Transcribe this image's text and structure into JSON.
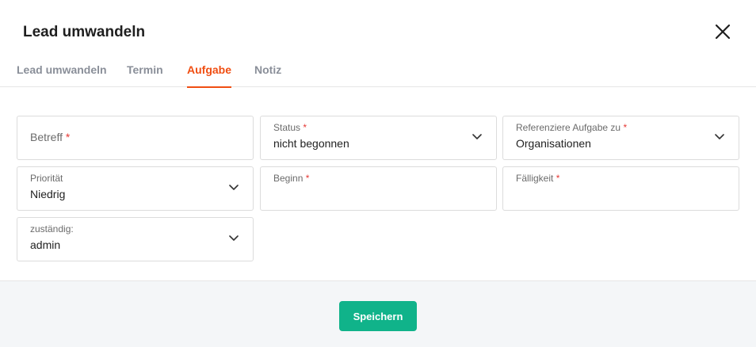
{
  "dialog": {
    "title": "Lead umwandeln",
    "close_icon": "close-icon"
  },
  "tabs": [
    {
      "label": "Lead umwandeln",
      "active": false
    },
    {
      "label": "Termin",
      "active": false
    },
    {
      "label": "Aufgabe",
      "active": true
    },
    {
      "label": "Notiz",
      "active": false
    }
  ],
  "form": {
    "betreff": {
      "label": "Betreff",
      "required_mark": "*",
      "value": ""
    },
    "status": {
      "label": "Status",
      "required_mark": "*",
      "value": "nicht begonnen"
    },
    "referenz": {
      "label": "Referenziere Aufgabe zu",
      "required_mark": "*",
      "value": "Organisationen"
    },
    "prioritaet": {
      "label": "Priorität",
      "value": "Niedrig"
    },
    "beginn": {
      "label": "Beginn",
      "required_mark": "*",
      "value": ""
    },
    "faelligkeit": {
      "label": "Fälligkeit",
      "required_mark": "*",
      "value": ""
    },
    "zustaendig": {
      "label": "zuständig:",
      "value": "admin"
    }
  },
  "footer": {
    "save_label": "Speichern"
  },
  "colors": {
    "accent_tab": "#f04e12",
    "save_button": "#10b38a",
    "required": "#e53935"
  }
}
